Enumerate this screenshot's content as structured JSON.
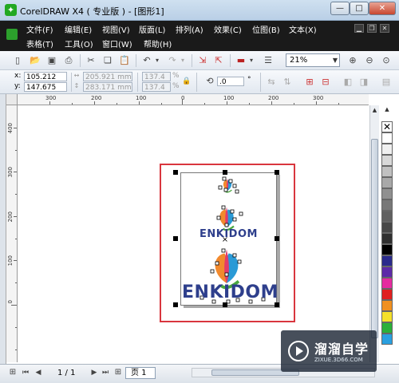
{
  "window": {
    "title": "CorelDRAW X4 ( 专业版 ) - [图形1]",
    "minimize_glyph": "—",
    "maximize_glyph": "□",
    "close_glyph": "✕"
  },
  "menu": {
    "row1": [
      "文件(F)",
      "编辑(E)",
      "视图(V)",
      "版面(L)",
      "排列(A)",
      "效果(C)",
      "位图(B)",
      "文本(X)"
    ],
    "row2": [
      "表格(T)",
      "工具(O)",
      "窗口(W)",
      "帮助(H)"
    ],
    "mdi_minimize": "▁",
    "mdi_restore": "❐",
    "mdi_close": "✕"
  },
  "toolbar": {
    "zoom_value": "21%",
    "icons": [
      "new-document-icon",
      "open-icon",
      "save-icon",
      "print-icon",
      "cut-icon",
      "copy-icon",
      "paste-icon",
      "undo-icon",
      "redo-icon",
      "import-icon",
      "export-icon",
      "application-launcher-icon",
      "welcome-screen-icon",
      "zoom-in-icon",
      "zoom-out-icon"
    ]
  },
  "properties": {
    "x_label": "x:",
    "x_value": "105.212 mm",
    "y_label": "y:",
    "y_value": "147.675 mm",
    "width_value": "205.921 mm",
    "height_value": "283.171 mm",
    "scale_x": "137.4",
    "scale_y": "137.4",
    "percent": "%",
    "rotation_value": ".0",
    "degree": "°"
  },
  "rulers": {
    "horizontal": [
      "300",
      "200",
      "100",
      "0",
      "100",
      "200",
      "300"
    ],
    "vertical": [
      "400",
      "300",
      "200",
      "100",
      "0"
    ]
  },
  "canvas": {
    "logo_texts": [
      "ENKIDOM",
      "ENKIDOM"
    ],
    "highlight_color": "#d9363e"
  },
  "palette": [
    "#ffffff",
    "#f0f0f0",
    "#d8d8d8",
    "#c0c0c0",
    "#a8a8a8",
    "#909090",
    "#787878",
    "#606060",
    "#484848",
    "#303030",
    "#000000",
    "#2a2a8c",
    "#5d2aa8",
    "#e52ba0",
    "#e02020",
    "#f09020",
    "#f4e02a",
    "#2ab03a",
    "#2aa0e0",
    "#1e3da8"
  ],
  "status": {
    "page_count": "1 / 1",
    "page_tab": "页 1"
  },
  "watermark": {
    "title": "溜溜自学",
    "subtitle": "ZIXUE.3D66.COM"
  }
}
